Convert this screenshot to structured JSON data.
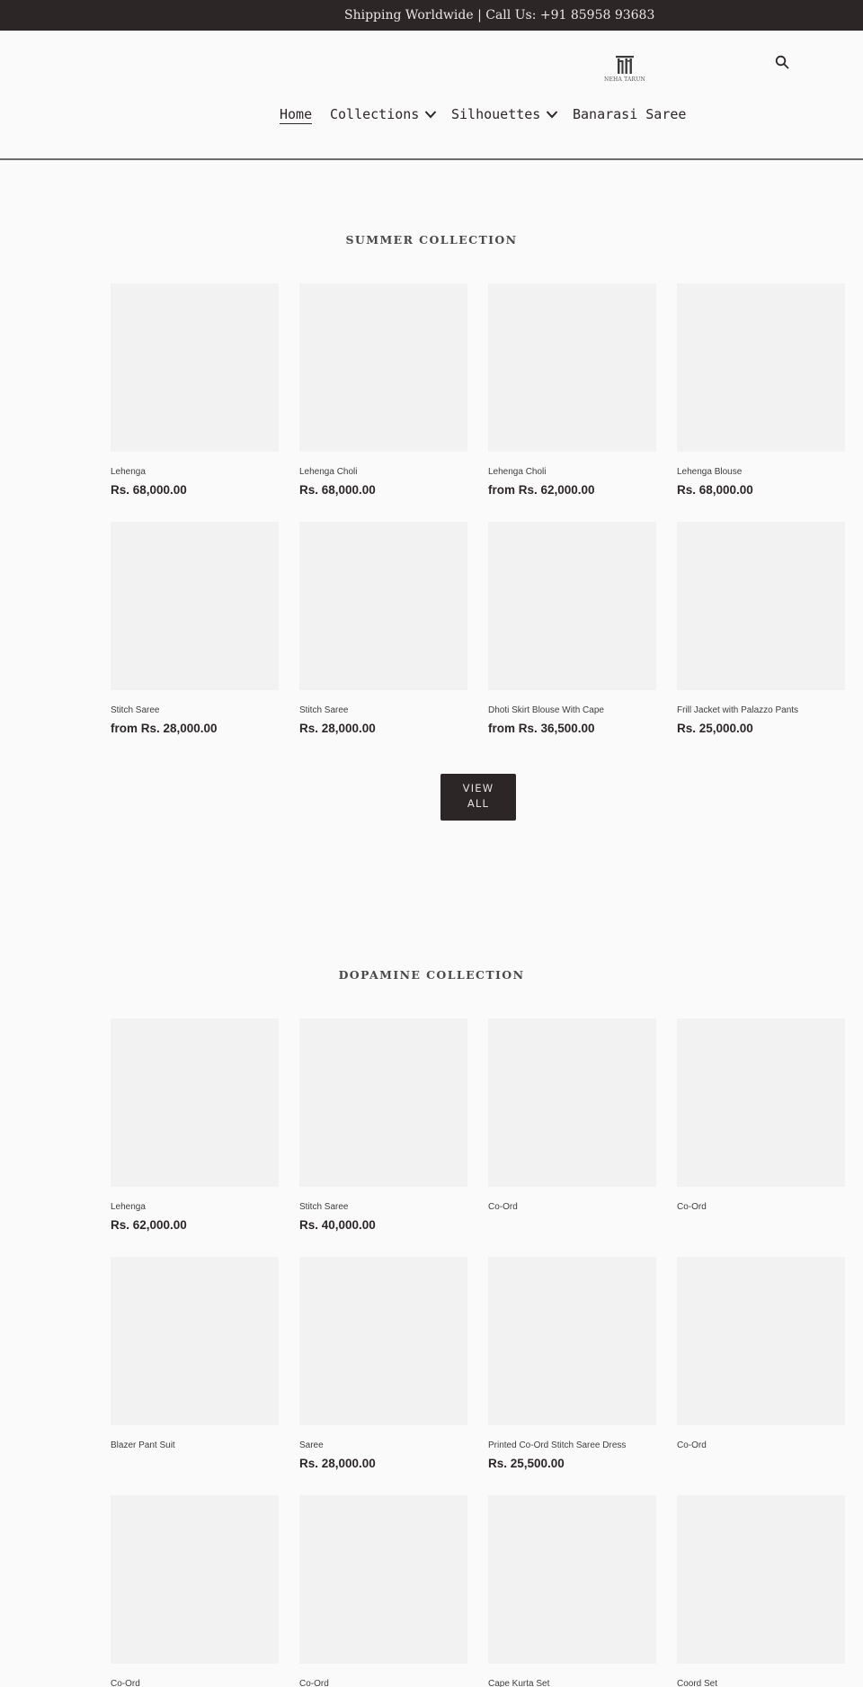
{
  "announcement": {
    "text": "Shipping Worldwide | Call Us: +91 85958 93683"
  },
  "header": {
    "logo_text": "NEHA TARUN",
    "search_icon": "search-icon",
    "nav": [
      {
        "label": "Home",
        "active": true,
        "has_dropdown": false
      },
      {
        "label": "Collections",
        "active": false,
        "has_dropdown": true
      },
      {
        "label": "Silhouettes",
        "active": false,
        "has_dropdown": true
      },
      {
        "label": "Banarasi Saree",
        "active": false,
        "has_dropdown": false
      }
    ]
  },
  "summer": {
    "title": "Summer Collection",
    "view_all_line1": "VIEW",
    "view_all_line2": "ALL",
    "products": [
      {
        "title": "Lehenga",
        "price": "Rs. 68,000.00"
      },
      {
        "title": "Lehenga Choli",
        "price": "Rs. 68,000.00"
      },
      {
        "title": "Lehenga Choli",
        "price": "from Rs. 62,000.00"
      },
      {
        "title": "Lehenga Blouse",
        "price": "Rs. 68,000.00"
      },
      {
        "title": "Stitch Saree",
        "price": "from Rs. 28,000.00"
      },
      {
        "title": "Stitch Saree",
        "price": "Rs. 28,000.00"
      },
      {
        "title": "Dhoti Skirt Blouse With Cape",
        "price": "from Rs. 36,500.00"
      },
      {
        "title": "Frill Jacket with Palazzo Pants",
        "price": "Rs. 25,000.00"
      }
    ]
  },
  "dopamine": {
    "title": "Dopamine Collection",
    "products": [
      {
        "title": "Lehenga",
        "price": "Rs. 62,000.00"
      },
      {
        "title": "Stitch Saree",
        "price": "Rs. 40,000.00"
      },
      {
        "title": "Co-Ord",
        "price": ""
      },
      {
        "title": "Co-Ord",
        "price": ""
      },
      {
        "title": "Blazer Pant Suit",
        "price": ""
      },
      {
        "title": "Saree",
        "price": "Rs. 28,000.00"
      },
      {
        "title": "Printed Co-Ord Stitch Saree Dress",
        "price": "Rs. 25,500.00"
      },
      {
        "title": "Co-Ord",
        "price": ""
      },
      {
        "title": "Co-Ord",
        "price": ""
      },
      {
        "title": "Co-Ord",
        "price": ""
      },
      {
        "title": "Cape Kurta Set",
        "price": ""
      },
      {
        "title": "Coord Set",
        "price": ""
      }
    ]
  }
}
